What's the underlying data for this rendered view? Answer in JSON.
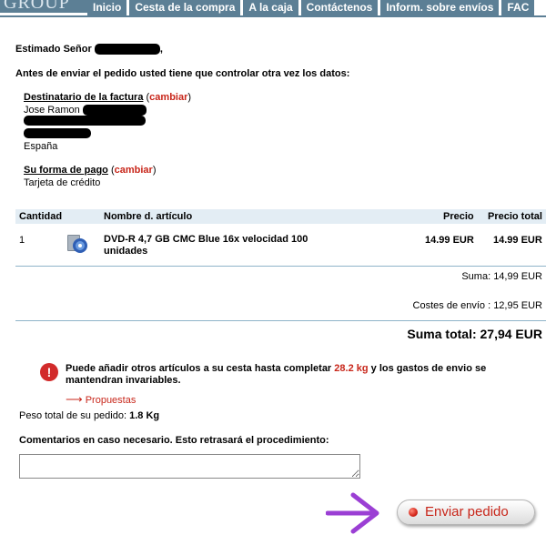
{
  "header": {
    "logo_text": "GROUP",
    "tabs": [
      "Inicio",
      "Cesta de la compra",
      "A la caja",
      "Contáctenos",
      "Inform. sobre envíos",
      "FAC"
    ]
  },
  "greeting": {
    "prefix": "Estimado Señor",
    "suffix": ","
  },
  "instruction": "Antes de enviar el pedido usted tiene que controlar otra vez los datos:",
  "billing": {
    "title": "Destinatario de la factura",
    "open_paren": "(",
    "change_label": "cambiar",
    "close_paren": ")",
    "name_visible": "Jose Ramon",
    "country": "España"
  },
  "payment": {
    "title": "Su forma de pago",
    "open_paren": "(",
    "change_label": "cambiar",
    "close_paren": ")",
    "method": "Tarjeta de crédito"
  },
  "table": {
    "headers": {
      "qty": "Cantidad",
      "name": "Nombre d. artículo",
      "price": "Precio",
      "total": "Precio total"
    },
    "row": {
      "qty": "1",
      "name_line1": "DVD-R 4,7 GB CMC Blue 16x velocidad 100",
      "name_line2": "unidades",
      "price": "14.99 EUR",
      "total": "14.99 EUR"
    }
  },
  "totals": {
    "sum": "Suma: 14,99 EUR",
    "shipping": "Costes de envío : 12,95 EUR",
    "grand_total": "Suma total: 27,94 EUR"
  },
  "notice": {
    "icon": "!",
    "line1_prefix": "Puede añadir otros artículos a su cesta hasta completar ",
    "weight": "28.2 kg",
    "line1_suffix": " y los gastos de envio se",
    "line2": "mantendran invariables.",
    "link": "Propuestas",
    "link_arrow": "⟶"
  },
  "weight": {
    "label": "Peso total de su pedido:",
    "value": "1.8 Kg"
  },
  "comments": {
    "label": "Comentarios en caso necesario. Esto retrasará el procedimiento:",
    "value": ""
  },
  "send_button": {
    "label": "Enviar pedido"
  },
  "colors": {
    "nav": "#5c7f95",
    "accent_red": "#c8261a",
    "table_header": "#e3edf4",
    "arrow": "#9b3fd4"
  }
}
